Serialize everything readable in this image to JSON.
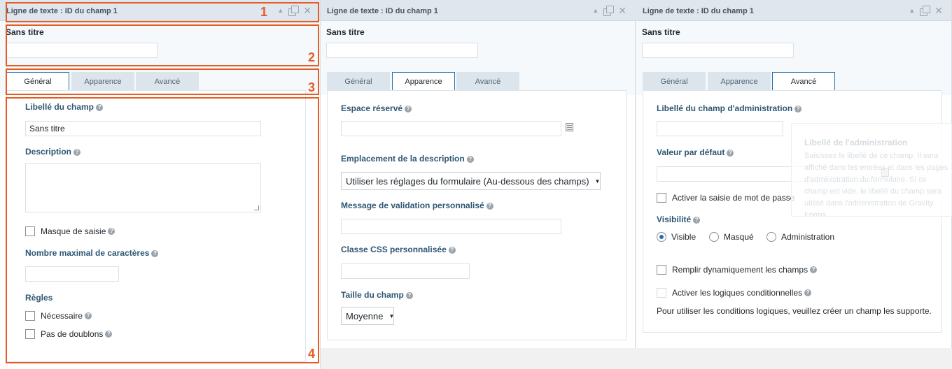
{
  "panels": [
    {
      "header": "Ligne de texte : ID du champ 1",
      "field_title": "Sans titre",
      "tabs": [
        "Général",
        "Apparence",
        "Avancé"
      ],
      "active_tab": 0,
      "general": {
        "label_field": "Libellé du champ",
        "label_value": "Sans titre",
        "description": "Description",
        "mask": "Masque de saisie",
        "max_chars": "Nombre maximal de caractères",
        "rules": "Règles",
        "required": "Nécessaire",
        "no_duplicates": "Pas de doublons"
      }
    },
    {
      "header": "Ligne de texte : ID du champ 1",
      "field_title": "Sans titre",
      "tabs": [
        "Général",
        "Apparence",
        "Avancé"
      ],
      "active_tab": 1,
      "appearance": {
        "placeholder": "Espace réservé",
        "desc_location": "Emplacement de la description",
        "desc_location_value": "Utiliser les réglages du formulaire (Au-dessous des champs)",
        "validation_message": "Message de validation personnalisé",
        "css_class": "Classe CSS personnalisée",
        "field_size": "Taille du champ",
        "field_size_value": "Moyenne"
      }
    },
    {
      "header": "Ligne de texte : ID du champ 1",
      "field_title": "Sans titre",
      "tabs": [
        "Général",
        "Apparence",
        "Avancé"
      ],
      "active_tab": 2,
      "advanced": {
        "admin_label": "Libellé du champ d'administration",
        "default_value": "Valeur par défaut",
        "password": "Activer la saisie de mot de passe",
        "visibility": "Visibilité",
        "vis_visible": "Visible",
        "vis_hidden": "Masqué",
        "vis_admin": "Administration",
        "dynamic_fill": "Remplir dynamiquement les champs",
        "conditional": "Activer les logiques conditionnelles",
        "conditional_note": "Pour utiliser les conditions logiques, veuillez créer un champ les supporte."
      }
    }
  ],
  "tooltip": {
    "title": "Libellé de l'administration",
    "text": "Saisissez le libellé de ce champ. Il sera affiché dans les entrées et dans les pages d'administration du formulaire. Si ce champ est vide, le libellé du champ sera utilisé dans l'administration de Gravity Forms."
  },
  "annotations": [
    "1",
    "2",
    "3",
    "4"
  ],
  "icons": {
    "help": "help-icon",
    "collapse": "collapse-arrow-icon",
    "duplicate": "duplicate-icon",
    "close": "close-icon",
    "merge_tag": "merge-tag-icon"
  },
  "colors": {
    "annotation": "#e35d25",
    "label": "#2e5673",
    "active_tab_border": "#2271b1"
  }
}
